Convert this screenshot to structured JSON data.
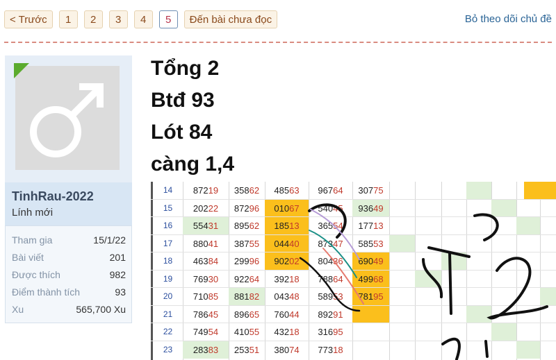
{
  "pagination": {
    "prev_label": "< Trước",
    "pages": [
      "1",
      "2",
      "3",
      "4",
      "5"
    ],
    "active_page": "5",
    "unread_label": "Đến bài chưa đọc"
  },
  "thread": {
    "unfollow_label": "Bỏ theo dõi chủ đề"
  },
  "colors": {
    "accent_orange": "#fbbf1c",
    "highlight_green": "#dff0d8",
    "link_blue": "#2a6496"
  },
  "user": {
    "avatar_icon": "male-symbol-icon",
    "name": "TinhRau-2022",
    "title": "Lính mới",
    "stats": [
      {
        "label": "Tham gia",
        "value": "15/1/22"
      },
      {
        "label": "Bài viết",
        "value": "201"
      },
      {
        "label": "Được thích",
        "value": "982"
      },
      {
        "label": "Điểm thành tích",
        "value": "93"
      },
      {
        "label": "Xu",
        "value": "565,700 Xu"
      }
    ]
  },
  "post": {
    "lines": [
      "Tổng 2",
      "Btđ 93",
      "Lót 84",
      "càng 1,4"
    ]
  },
  "table": {
    "rows": [
      {
        "n": "14",
        "cells": [
          "87219",
          "35862",
          "48563",
          "96764",
          "30775"
        ]
      },
      {
        "n": "15",
        "cells": [
          "20222",
          "87296",
          "01067",
          "54045",
          "93649"
        ]
      },
      {
        "n": "16",
        "cells": [
          "55431",
          "89562",
          "18513",
          "36554",
          "17713"
        ]
      },
      {
        "n": "17",
        "cells": [
          "88041",
          "38755",
          "04440",
          "87347",
          "58553"
        ]
      },
      {
        "n": "18",
        "cells": [
          "46384",
          "29996",
          "90202",
          "80436",
          "69049"
        ]
      },
      {
        "n": "19",
        "cells": [
          "76930",
          "92264",
          "39218",
          "78864",
          "49968"
        ]
      },
      {
        "n": "20",
        "cells": [
          "71085",
          "88182",
          "04348",
          "58953",
          "78195"
        ]
      },
      {
        "n": "21",
        "cells": [
          "78645",
          "89665",
          "76044",
          "89291",
          ""
        ]
      },
      {
        "n": "22",
        "cells": [
          "74954",
          "41055",
          "43218",
          "31695",
          ""
        ]
      },
      {
        "n": "23",
        "cells": [
          "28383",
          "25351",
          "38074",
          "77318",
          ""
        ]
      }
    ]
  },
  "handwriting_note": "T2 1"
}
